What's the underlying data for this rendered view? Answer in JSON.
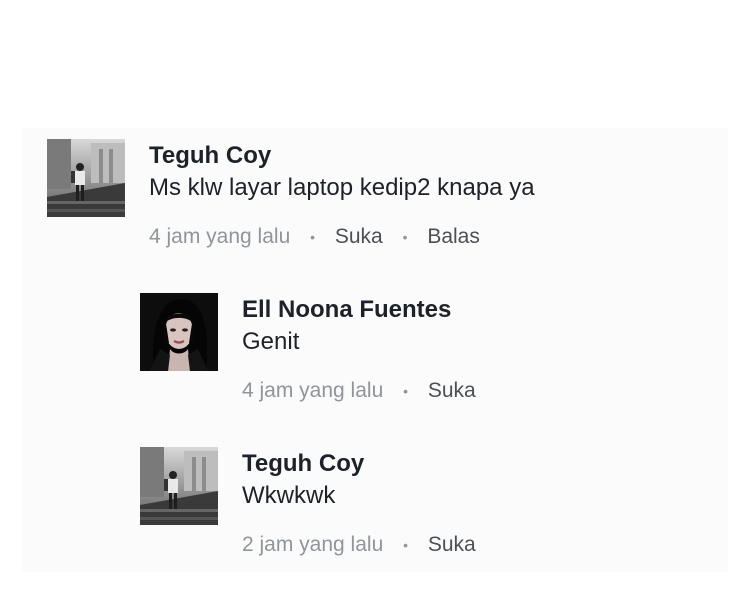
{
  "comments": [
    {
      "author": "Teguh Coy",
      "text": "Ms klw layar laptop kedip2 knapa ya",
      "time": "4 jam yang lalu",
      "like_label": "Suka",
      "reply_label": "Balas",
      "avatar_icon": "teguh-coy-avatar"
    },
    {
      "author": "Ell Noona Fuentes",
      "text": "Genit",
      "time": "4 jam yang lalu",
      "like_label": "Suka",
      "avatar_icon": "ell-noona-avatar"
    },
    {
      "author": "Teguh Coy",
      "text": "Wkwkwk",
      "time": "2 jam yang lalu",
      "like_label": "Suka",
      "avatar_icon": "teguh-coy-avatar"
    }
  ],
  "separator": "•",
  "colors": {
    "author": "#1d2129",
    "meta": "#90949c",
    "action": "#4b4f56",
    "panel_bg": "#fbfbfb"
  }
}
